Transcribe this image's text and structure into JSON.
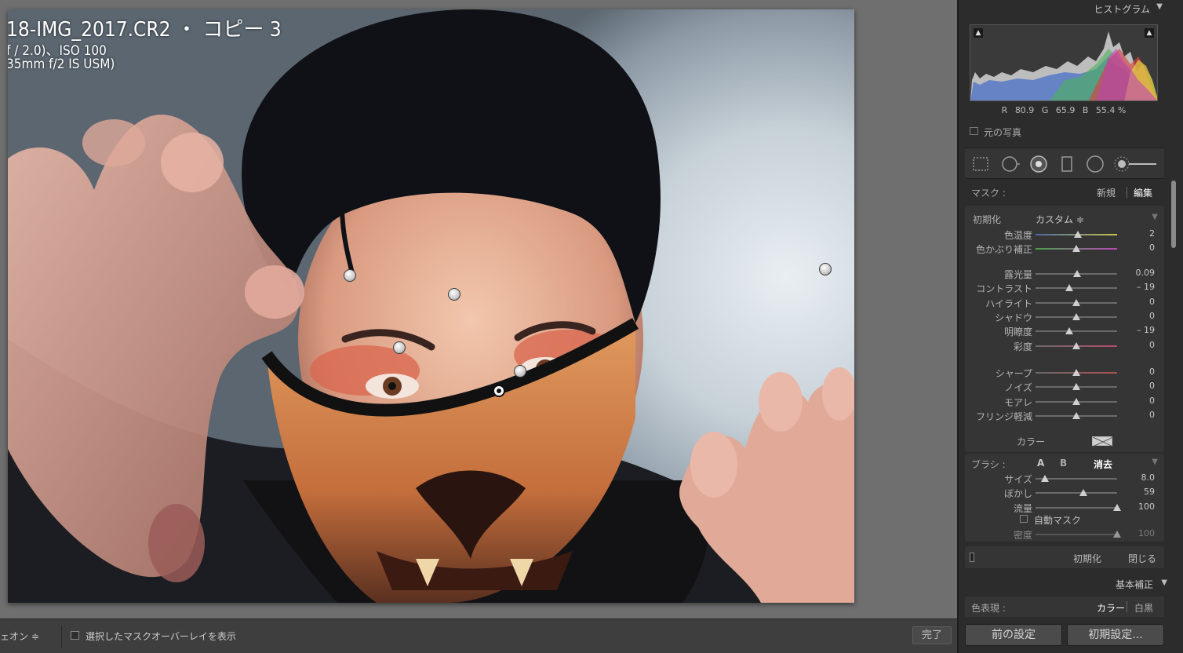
{
  "image": {
    "title": "18-IMG_2017.CR2 ・ コピー 3",
    "exposure_line": "f / 2.0)、ISO 100",
    "lens_line": "35mm f/2 IS USM)"
  },
  "bottom_toolbar": {
    "overlay_mode": "ェオン ≑",
    "show_overlay_label": "選択したマスクオーバーレイを表示",
    "done_label": "完了"
  },
  "panel": {
    "histogram": {
      "header": "ヒストグラム",
      "r_label": "R",
      "r_value": "80.9",
      "g_label": "G",
      "g_value": "65.9",
      "b_label": "B",
      "b_value": "55.4 %",
      "original_photo_label": "元の写真"
    },
    "mask": {
      "label": "マスク :",
      "new": "新規",
      "edit": "編集"
    },
    "adjustments": {
      "preset_label": "初期化",
      "preset_value": "カスタム ≑",
      "groups": [
        [
          {
            "label": "色温度",
            "value": "2",
            "pos": 0.52
          },
          {
            "label": "色かぶり補正",
            "value": "0",
            "pos": 0.5
          }
        ],
        [
          {
            "label": "露光量",
            "value": "0.09",
            "pos": 0.51
          },
          {
            "label": "コントラスト",
            "value": "– 19",
            "pos": 0.41
          },
          {
            "label": "ハイライト",
            "value": "0",
            "pos": 0.5
          },
          {
            "label": "シャドウ",
            "value": "0",
            "pos": 0.5
          },
          {
            "label": "明瞭度",
            "value": "– 19",
            "pos": 0.41
          },
          {
            "label": "彩度",
            "value": "0",
            "pos": 0.5
          }
        ],
        [
          {
            "label": "シャープ",
            "value": "0",
            "pos": 0.5
          },
          {
            "label": "ノイズ",
            "value": "0",
            "pos": 0.5
          },
          {
            "label": "モアレ",
            "value": "0",
            "pos": 0.5
          },
          {
            "label": "フリンジ軽減",
            "value": "0",
            "pos": 0.5
          }
        ]
      ],
      "color_label": "カラー"
    },
    "brush": {
      "label": "ブラシ :",
      "a": "A",
      "b": "B",
      "erase": "消去",
      "sliders": [
        {
          "label": "サイズ",
          "value": "8.0",
          "pos": 0.12
        },
        {
          "label": "ぼかし",
          "value": "59",
          "pos": 0.59
        },
        {
          "label": "流量",
          "value": "100",
          "pos": 1.0
        }
      ],
      "auto_mask": "自動マスク",
      "density_label": "密度",
      "density_value": "100",
      "density_pos": 1.0
    },
    "footer": {
      "reset": "初期化",
      "close": "閉じる"
    },
    "basic": {
      "header": "基本補正",
      "treatment_label": "色表現 :",
      "color": "カラー",
      "bw": "白黒"
    },
    "prev_button": "前の設定",
    "reset_button": "初期設定..."
  }
}
